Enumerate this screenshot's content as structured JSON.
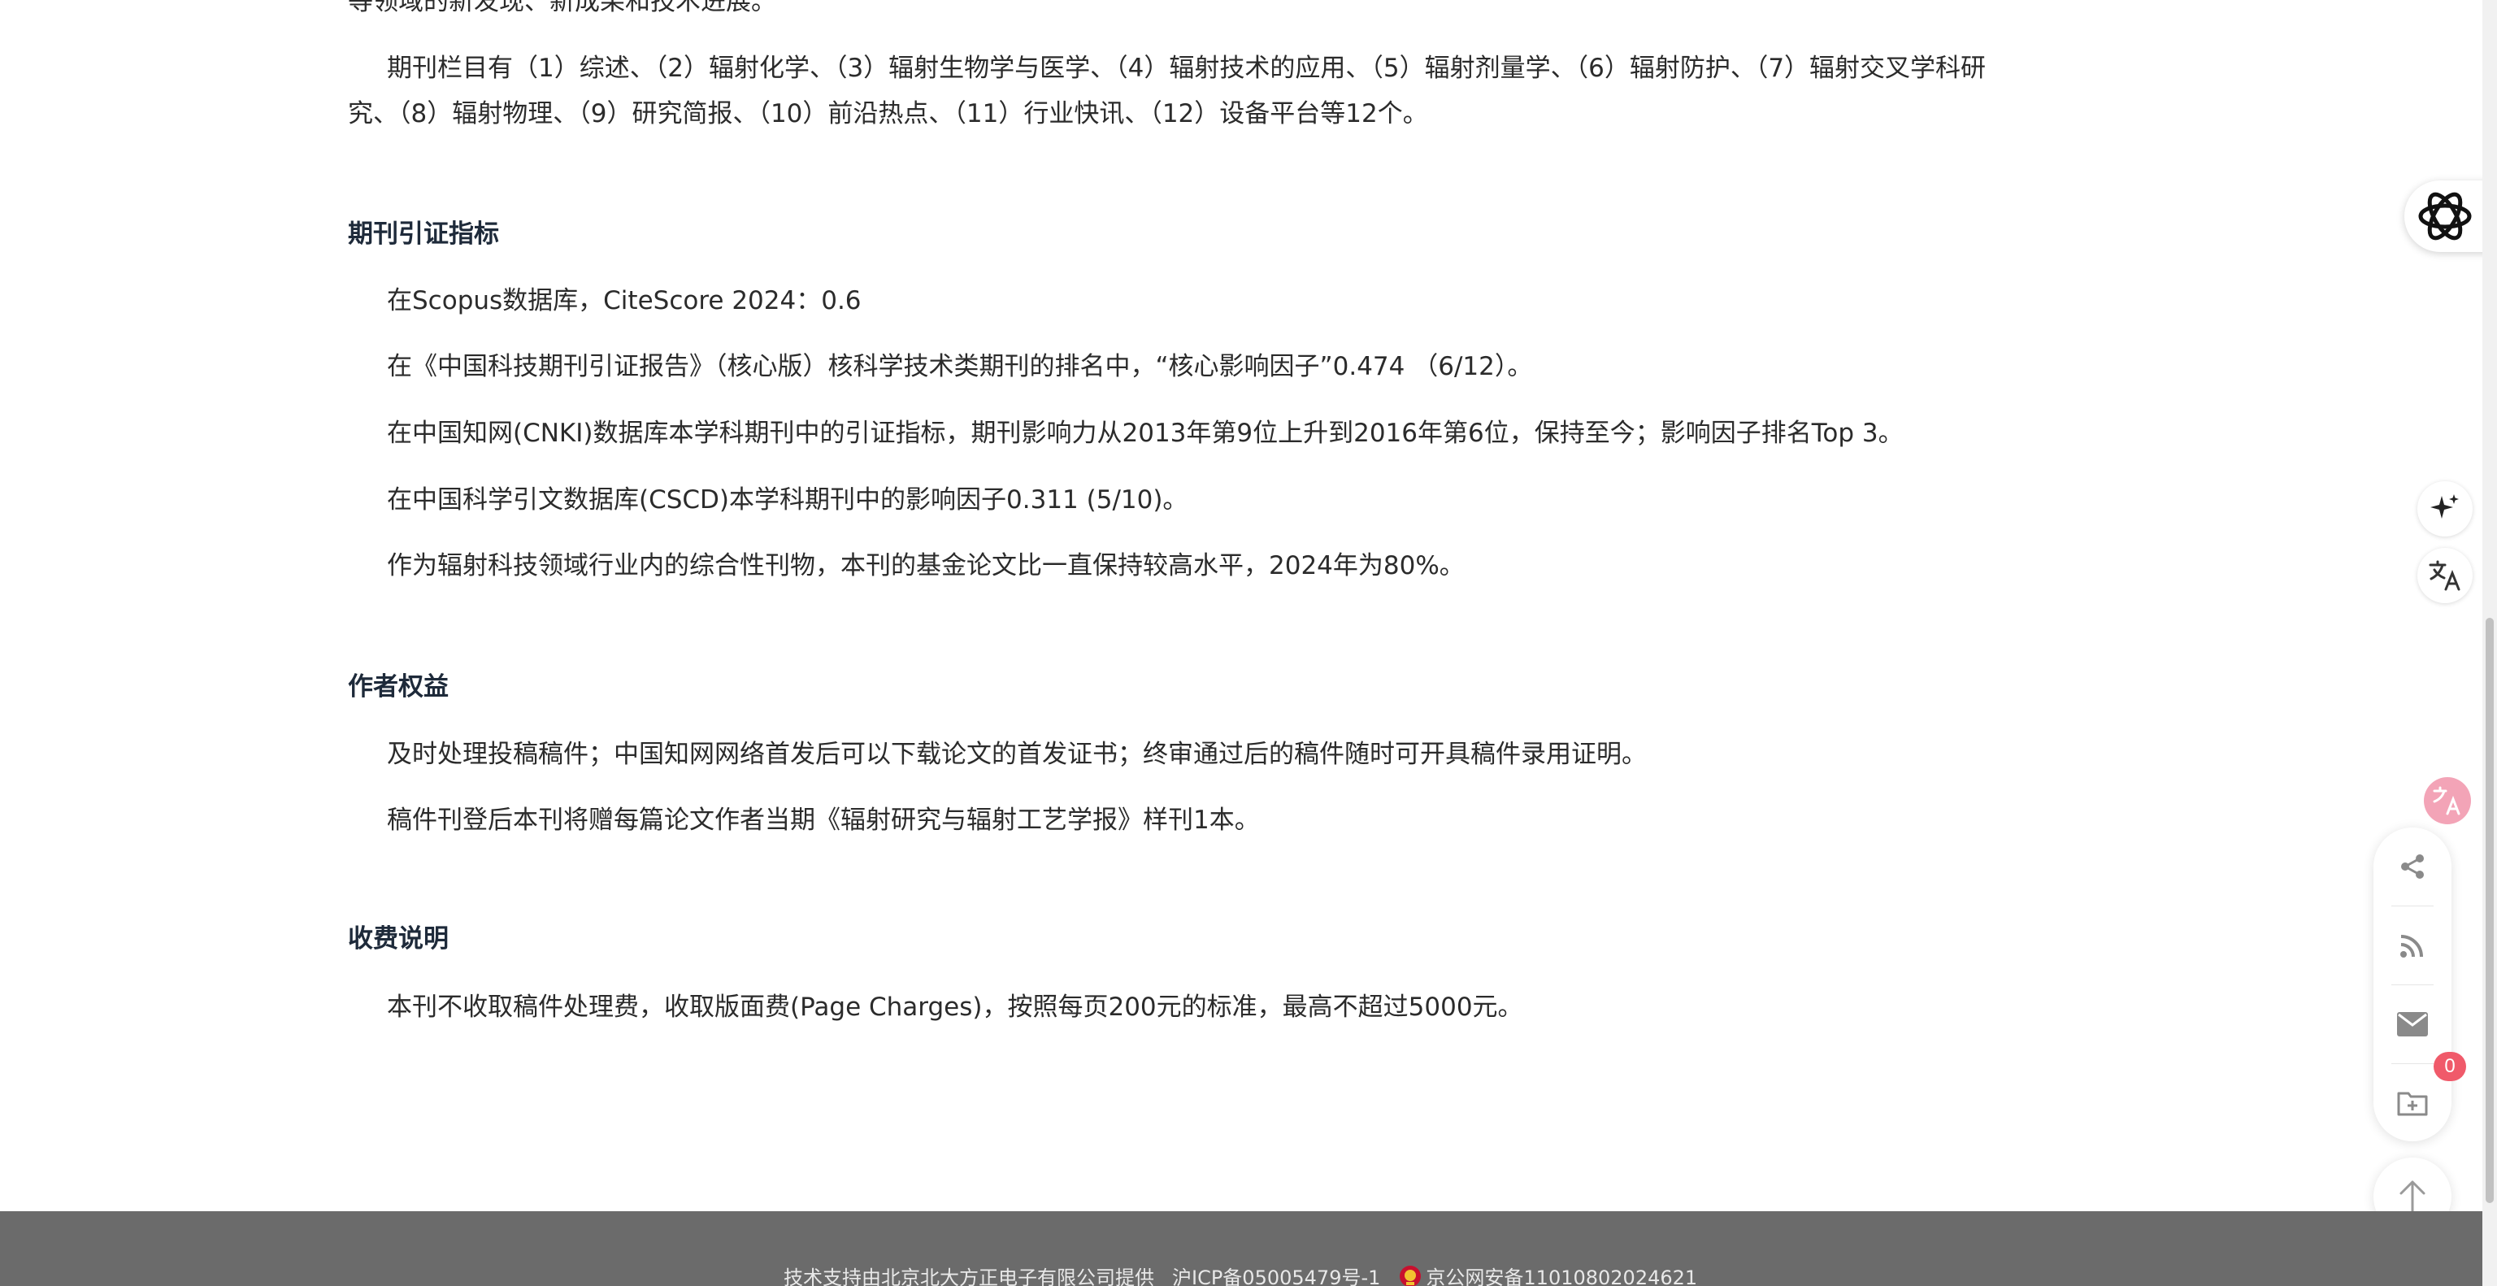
{
  "article": {
    "top_fragment": "等领域的新发现、新成果和技术进展。",
    "columns_line1": "期刊栏目有（1）综述、（2）辐射化学、（3）辐射生物学与医学、（4）辐射技术的应用、（5）辐射剂量学、（6）辐射防护、（7）辐射交叉学科研",
    "columns_line2": "究、（8）辐射物理、（9）研究简报、（10）前沿热点、（11）行业快讯、（12）设备平台等12个。",
    "sections": [
      {
        "heading": "期刊引证指标",
        "paragraphs": [
          "在Scopus数据库，CiteScore 2024：0.6",
          "在《中国科技期刊引证报告》（核心版）核科学技术类期刊的排名中，“核心影响因子”0.474 （6/12）。",
          "在中国知网(CNKI)数据库本学科期刊中的引证指标，期刊影响力从2013年第9位上升到2016年第6位，保持至今；影响因子排名Top 3。",
          "在中国科学引文数据库(CSCD)本学科期刊中的影响因子0.311 (5/10)。",
          "作为辐射科技领域行业内的综合性刊物，本刊的基金论文比一直保持较高水平，2024年为80%。"
        ]
      },
      {
        "heading": "作者权益",
        "paragraphs": [
          "及时处理投稿稿件；中国知网网络首发后可以下载论文的首发证书；终审通过后的稿件随时可开具稿件录用证明。",
          "稿件刊登后本刊将赠每篇论文作者当期《辐射研究与辐射工艺学报》样刊1本。"
        ]
      },
      {
        "heading": "收费说明",
        "paragraphs": [
          "本刊不收取稿件处理费，收取版面费(Page Charges)，按照每页200元的标准，最高不超过5000元。"
        ]
      }
    ]
  },
  "tools": {
    "folder_badge_count": "0",
    "icons": [
      "ai-assistant-icon",
      "sparkle-icon",
      "translate-icon",
      "translate-fab-icon",
      "share-icon",
      "rss-icon",
      "mail-icon",
      "folder-add-icon",
      "back-to-top-icon"
    ],
    "translate_fab_color": "#f3a4b7",
    "badge_color": "#f05a6a"
  },
  "footer": {
    "support": "技术支持由北京北大方正电子有限公司提供",
    "icp": "沪ICP备05005479号-1",
    "police": "京公网安备11010802024621",
    "background": "#6b6b6b"
  }
}
